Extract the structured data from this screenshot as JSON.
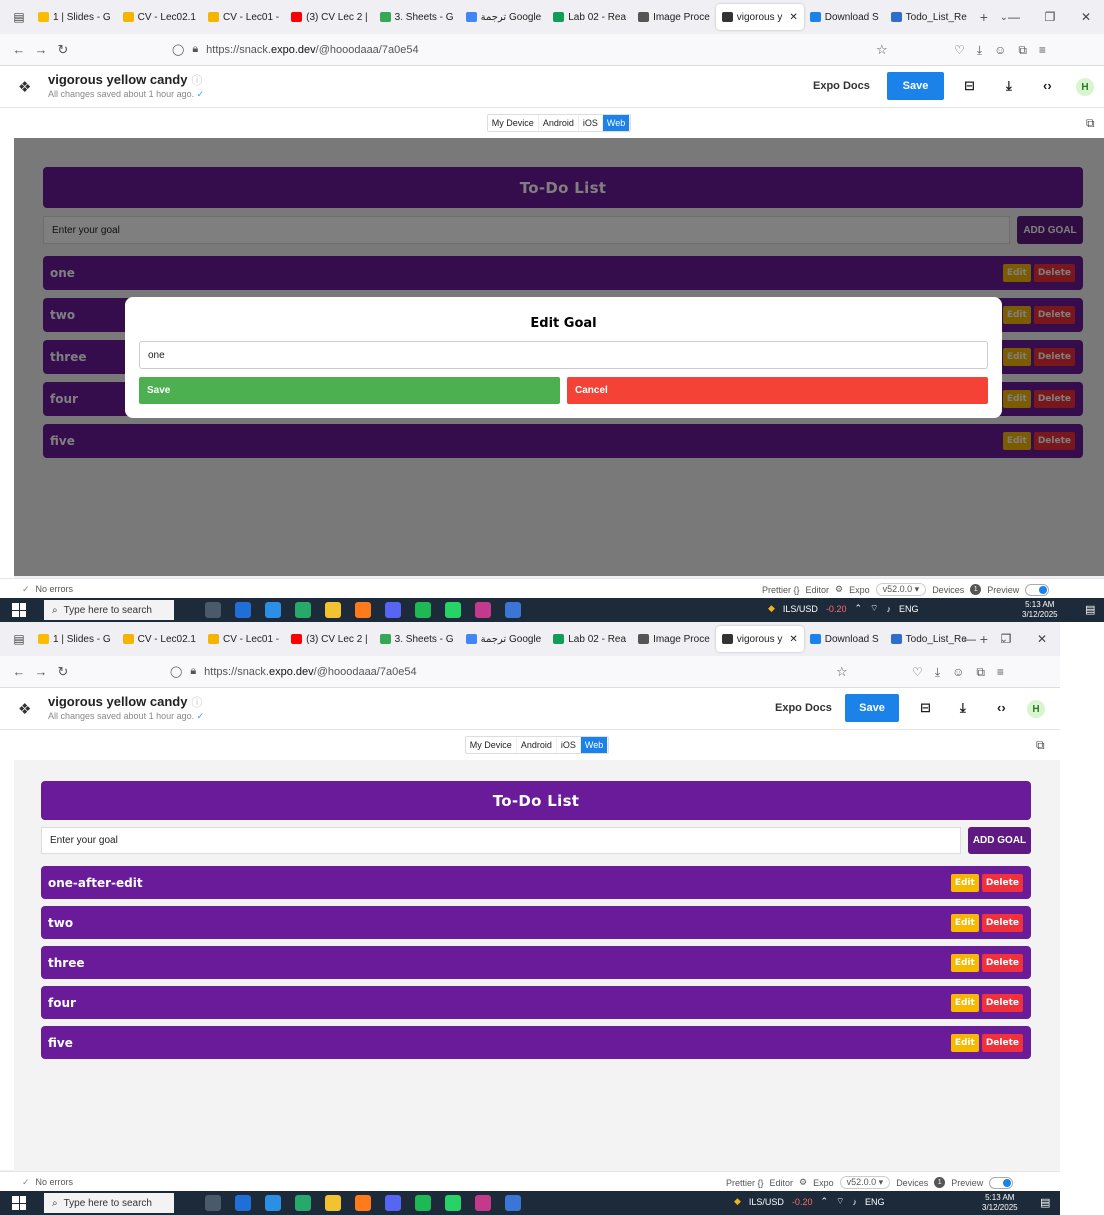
{
  "browser": {
    "tabs": [
      {
        "label": "1 | Slides - G",
        "color": "#fbbc04"
      },
      {
        "label": "CV - Lec02.1",
        "color": "#f4b400"
      },
      {
        "label": "CV - Lec01 -",
        "color": "#f4b400"
      },
      {
        "label": "(3) CV Lec 2 |",
        "color": "#ff0000"
      },
      {
        "label": "3. Sheets - G",
        "color": "#34a853"
      },
      {
        "label": "ترجمة Google",
        "color": "#4285f4"
      },
      {
        "label": "Lab 02 - Rea",
        "color": "#0f9d58"
      },
      {
        "label": "Image Proce",
        "color": "#555555"
      },
      {
        "label": "vigorous y",
        "color": "#333333",
        "active": true
      },
      {
        "label": "Download S",
        "color": "#1a82e8"
      },
      {
        "label": "Todo_List_Re",
        "color": "#2f6fc9"
      }
    ],
    "url_prefix": "https://snack.",
    "url_host": "expo.dev",
    "url_path": "/@hooodaaa/7a0e54"
  },
  "snack": {
    "project_name": "vigorous yellow candy",
    "status": "All changes saved about 1 hour ago.",
    "expo_docs": "Expo Docs",
    "save_label": "Save",
    "avatar_letter": "H",
    "platforms": [
      "My Device",
      "Android",
      "iOS",
      "Web"
    ],
    "active_platform": "Web"
  },
  "app": {
    "title": "To-Do List",
    "input_placeholder": "Enter your goal",
    "add_label": "ADD GOAL",
    "edit_label": "Edit",
    "delete_label": "Delete"
  },
  "shot1": {
    "goals": [
      "one",
      "two",
      "three",
      "four",
      "five"
    ],
    "modal": {
      "title": "Edit Goal",
      "input_value": "one",
      "save_label": "Save",
      "cancel_label": "Cancel"
    }
  },
  "shot2": {
    "goals": [
      "one-after-edit",
      "two",
      "three",
      "four",
      "five"
    ]
  },
  "statusbar": {
    "errors": "No errors",
    "prettier": "Prettier {}",
    "editor": "Editor",
    "expo": "Expo",
    "version": "v52.0.0 ▾",
    "devices": "Devices",
    "device_count": "1",
    "preview": "Preview"
  },
  "taskbar": {
    "search_placeholder": "Type here to search",
    "currency": "ILS/USD",
    "currency_change": "-0.20",
    "language": "ENG",
    "time": "5:13 AM",
    "date": "3/12/2025"
  },
  "colors": {
    "purple": "#6a1b9a",
    "edit": "#f9b800",
    "delete": "#f0303a",
    "save_green": "#4caf50",
    "cancel_red": "#f44336",
    "accent": "#1a82e8"
  }
}
